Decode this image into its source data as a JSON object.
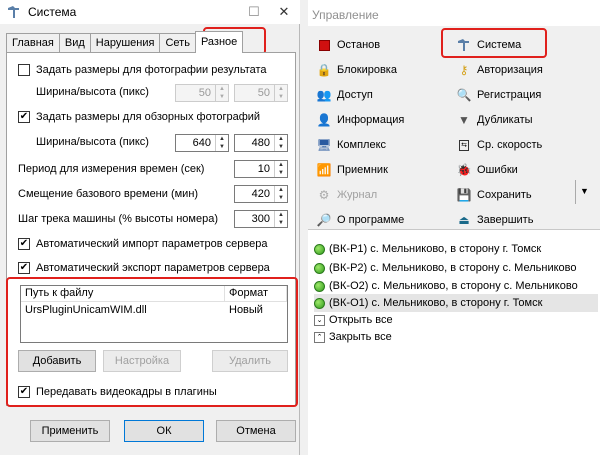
{
  "dialog": {
    "title": "Система",
    "tabs": [
      "Главная",
      "Вид",
      "Нарушения",
      "Сеть",
      "Разное"
    ],
    "active_tab": "Разное",
    "result_size": {
      "label": "Задать размеры для фотографии результата",
      "checked": false,
      "wh_label": "Ширина/высота (пикс)",
      "width": "50",
      "height": "50"
    },
    "overview_size": {
      "label": "Задать размеры для обзорных фотографий",
      "checked": true,
      "wh_label": "Ширина/высота (пикс)",
      "width": "640",
      "height": "480"
    },
    "period": {
      "label": "Период для измерения времен (сек)",
      "value": "10"
    },
    "offset": {
      "label": "Смещение базового времени (мин)",
      "value": "420"
    },
    "track_step": {
      "label": "Шаг трека машины (% высоты номера)",
      "value": "300"
    },
    "auto_import": {
      "label": "Автоматический импорт параметров сервера",
      "checked": true
    },
    "auto_export": {
      "label": "Автоматический экспорт параметров сервера",
      "checked": true
    },
    "plugins": {
      "col_path": "Путь к файлу",
      "col_format": "Формат",
      "rows": [
        {
          "path": "UrsPluginUnicamWIM.dll",
          "format": "Новый"
        }
      ]
    },
    "add_btn": "Добавить",
    "setup_btn": "Настройка",
    "delete_btn": "Удалить",
    "send_frames": {
      "label": "Передавать видеокадры в плагины",
      "checked": true
    },
    "apply_btn": "Применить",
    "ok_btn": "ОК",
    "cancel_btn": "Отмена"
  },
  "panel": {
    "title": "Управление",
    "menu": [
      {
        "label": "Останов",
        "icon": "stop-icon"
      },
      {
        "label": "Система",
        "icon": "tools-icon"
      },
      {
        "label": "Блокировка",
        "icon": "lock-icon"
      },
      {
        "label": "Авторизация",
        "icon": "key-icon"
      },
      {
        "label": "Доступ",
        "icon": "users-icon"
      },
      {
        "label": "Регистрация",
        "icon": "magnifier-icon"
      },
      {
        "label": "Информация",
        "icon": "info-user-icon"
      },
      {
        "label": "Дубликаты",
        "icon": "filter-icon"
      },
      {
        "label": "Комплекс",
        "icon": "monitor-icon"
      },
      {
        "label": "Ср. скорость",
        "icon": "speed-icon"
      },
      {
        "label": "Приемник",
        "icon": "receiver-icon"
      },
      {
        "label": "Ошибки",
        "icon": "bug-icon"
      },
      {
        "label": "Журнал",
        "icon": "journal-icon",
        "disabled": true
      },
      {
        "label": "Сохранить",
        "icon": "save-icon"
      },
      {
        "label": "О программе",
        "icon": "about-icon"
      },
      {
        "label": "Завершить",
        "icon": "exit-icon"
      }
    ],
    "cameras": [
      "(ВК-Р1) с. Мельниково, в сторону г. Томск",
      "(ВК-Р2) с. Мельниково, в сторону с. Мельниково",
      "(ВК-О2) с. Мельниково, в сторону с. Мельниково",
      "(ВК-О1) с. Мельниково, в сторону г. Томск"
    ],
    "expand_all": "Открыть все",
    "collapse_all": "Закрыть все"
  }
}
